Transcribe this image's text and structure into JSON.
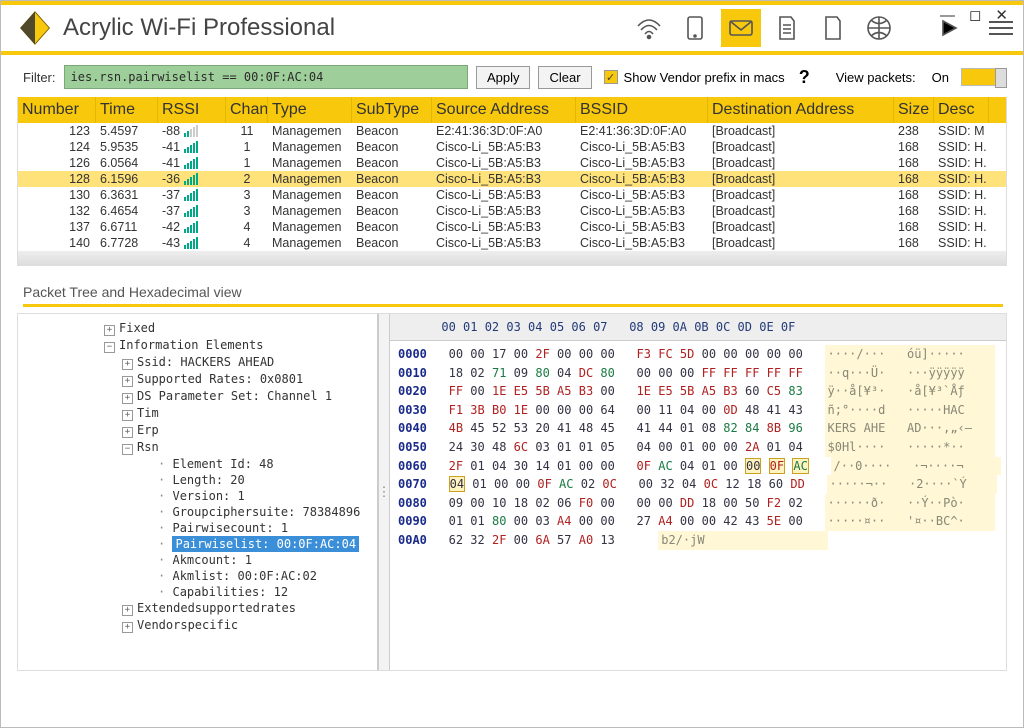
{
  "app": {
    "title": "Acrylic Wi-Fi Professional"
  },
  "filter": {
    "label": "Filter:",
    "value": "ies.rsn.pairwiselist == 00:0F:AC:04",
    "apply": "Apply",
    "clear": "Clear",
    "vendor_prefix": "Show Vendor prefix in macs",
    "view_packets": "View packets:",
    "toggle": "On"
  },
  "columns": [
    "Number",
    "Time",
    "RSSI",
    "Chan",
    "Type",
    "SubType",
    "Source Address",
    "BSSID",
    "Destination Address",
    "Size",
    "Desc"
  ],
  "rows": [
    {
      "num": "123",
      "time": "5.4597",
      "rssi": "-88",
      "sig": 2,
      "chan": "11",
      "type": "Managemen",
      "sub": "Beacon",
      "src": "E2:41:36:3D:0F:A0",
      "bssid": "E2:41:36:3D:0F:A0",
      "dst": "[Broadcast]",
      "size": "238",
      "desc": "SSID: M"
    },
    {
      "num": "124",
      "time": "5.9535",
      "rssi": "-41",
      "sig": 5,
      "chan": "1",
      "type": "Managemen",
      "sub": "Beacon",
      "src": "Cisco-Li_5B:A5:B3",
      "bssid": "Cisco-Li_5B:A5:B3",
      "dst": "[Broadcast]",
      "size": "168",
      "desc": "SSID: H."
    },
    {
      "num": "126",
      "time": "6.0564",
      "rssi": "-41",
      "sig": 5,
      "chan": "1",
      "type": "Managemen",
      "sub": "Beacon",
      "src": "Cisco-Li_5B:A5:B3",
      "bssid": "Cisco-Li_5B:A5:B3",
      "dst": "[Broadcast]",
      "size": "168",
      "desc": "SSID: H."
    },
    {
      "num": "128",
      "time": "6.1596",
      "rssi": "-36",
      "sig": 5,
      "chan": "2",
      "type": "Managemen",
      "sub": "Beacon",
      "src": "Cisco-Li_5B:A5:B3",
      "bssid": "Cisco-Li_5B:A5:B3",
      "dst": "[Broadcast]",
      "size": "168",
      "desc": "SSID: H.",
      "sel": true
    },
    {
      "num": "130",
      "time": "6.3631",
      "rssi": "-37",
      "sig": 5,
      "chan": "3",
      "type": "Managemen",
      "sub": "Beacon",
      "src": "Cisco-Li_5B:A5:B3",
      "bssid": "Cisco-Li_5B:A5:B3",
      "dst": "[Broadcast]",
      "size": "168",
      "desc": "SSID: H."
    },
    {
      "num": "132",
      "time": "6.4654",
      "rssi": "-37",
      "sig": 5,
      "chan": "3",
      "type": "Managemen",
      "sub": "Beacon",
      "src": "Cisco-Li_5B:A5:B3",
      "bssid": "Cisco-Li_5B:A5:B3",
      "dst": "[Broadcast]",
      "size": "168",
      "desc": "SSID: H."
    },
    {
      "num": "137",
      "time": "6.6711",
      "rssi": "-42",
      "sig": 5,
      "chan": "4",
      "type": "Managemen",
      "sub": "Beacon",
      "src": "Cisco-Li_5B:A5:B3",
      "bssid": "Cisco-Li_5B:A5:B3",
      "dst": "[Broadcast]",
      "size": "168",
      "desc": "SSID: H."
    },
    {
      "num": "140",
      "time": "6.7728",
      "rssi": "-43",
      "sig": 5,
      "chan": "4",
      "type": "Managemen",
      "sub": "Beacon",
      "src": "Cisco-Li_5B:A5:B3",
      "bssid": "Cisco-Li_5B:A5:B3",
      "dst": "[Broadcast]",
      "size": "168",
      "desc": "SSID: H."
    }
  ],
  "tree_section_title": "Packet Tree and Hexadecimal view",
  "tree": {
    "fixed": "Fixed",
    "ie": "Information Elements",
    "ssid": "Ssid: HACKERS AHEAD",
    "rates": "Supported Rates: 0x0801",
    "ds": "DS Parameter Set: Channel 1",
    "tim": "Tim",
    "erp": "Erp",
    "rsn": "Rsn",
    "eid": "Element Id: 48",
    "len": "Length: 20",
    "ver": "Version: 1",
    "gcs": "Groupciphersuite: 78384896",
    "pwc": "Pairwisecount: 1",
    "pwl": "Pairwiselist: 00:0F:AC:04",
    "akmc": "Akmcount: 1",
    "akml": "Akmlist: 00:0F:AC:02",
    "cap": "Capabilities: 12",
    "ext": "Extendedsupportedrates",
    "vspec": "Vendorspecific"
  },
  "hex": {
    "header": "      00 01 02 03 04 05 06 07   08 09 0A 0B 0C 0D 0E 0F",
    "rows": [
      {
        "o": "0000",
        "l": "00 00 17 00 2F 00 00 00",
        "r": "F3 FC 5D 00 00 00 00 00",
        "a": "····/···   óü]·····"
      },
      {
        "o": "0010",
        "l": "18 02 71 09 80 04 DC 80",
        "r": "00 00 00 FF FF FF FF FF",
        "a": "··q···Ü·   ···ÿÿÿÿÿ"
      },
      {
        "o": "0020",
        "l": "FF 00 1E E5 5B A5 B3 00",
        "r": "1E E5 5B A5 B3 60 C5 83",
        "a": "ÿ··å[¥³·   ·å[¥³`Åƒ"
      },
      {
        "o": "0030",
        "l": "F1 3B B0 1E 00 00 00 64",
        "r": "00 11 04 00 0D 48 41 43",
        "a": "ñ;°····d   ·····HAC"
      },
      {
        "o": "0040",
        "l": "4B 45 52 53 20 41 48 45",
        "r": "41 44 01 08 82 84 8B 96",
        "a": "KERS AHE   AD···‚„‹–"
      },
      {
        "o": "0050",
        "l": "24 30 48 6C 03 01 01 05",
        "r": "04 00 01 00 00 2A 01 04",
        "a": "$0Hl····   ·····*··"
      },
      {
        "o": "0060",
        "l": "2F 01 04 30 14 01 00 00",
        "r": "0F AC 04 01 00 00 0F AC",
        "a": "/··0····   ·¬····¬",
        "hl": [
          13,
          14,
          15
        ]
      },
      {
        "o": "0070",
        "l": "04 01 00 00 0F AC 02 0C",
        "r": "00 32 04 0C 12 18 60 DD",
        "a": "·····¬··   ·2····`Ý",
        "hl": [
          0
        ]
      },
      {
        "o": "0080",
        "l": "09 00 10 18 02 06 F0 00",
        "r": "00 00 DD 18 00 50 F2 02",
        "a": "······ð·   ··Ý··Pò·"
      },
      {
        "o": "0090",
        "l": "01 01 80 00 03 A4 00 00",
        "r": "27 A4 00 00 42 43 5E 00",
        "a": "·····¤··   '¤··BC^·"
      },
      {
        "o": "00A0",
        "l": "62 32 2F 00 6A 57 A0 13",
        "r": "",
        "a": "b2/·jW "
      }
    ]
  }
}
